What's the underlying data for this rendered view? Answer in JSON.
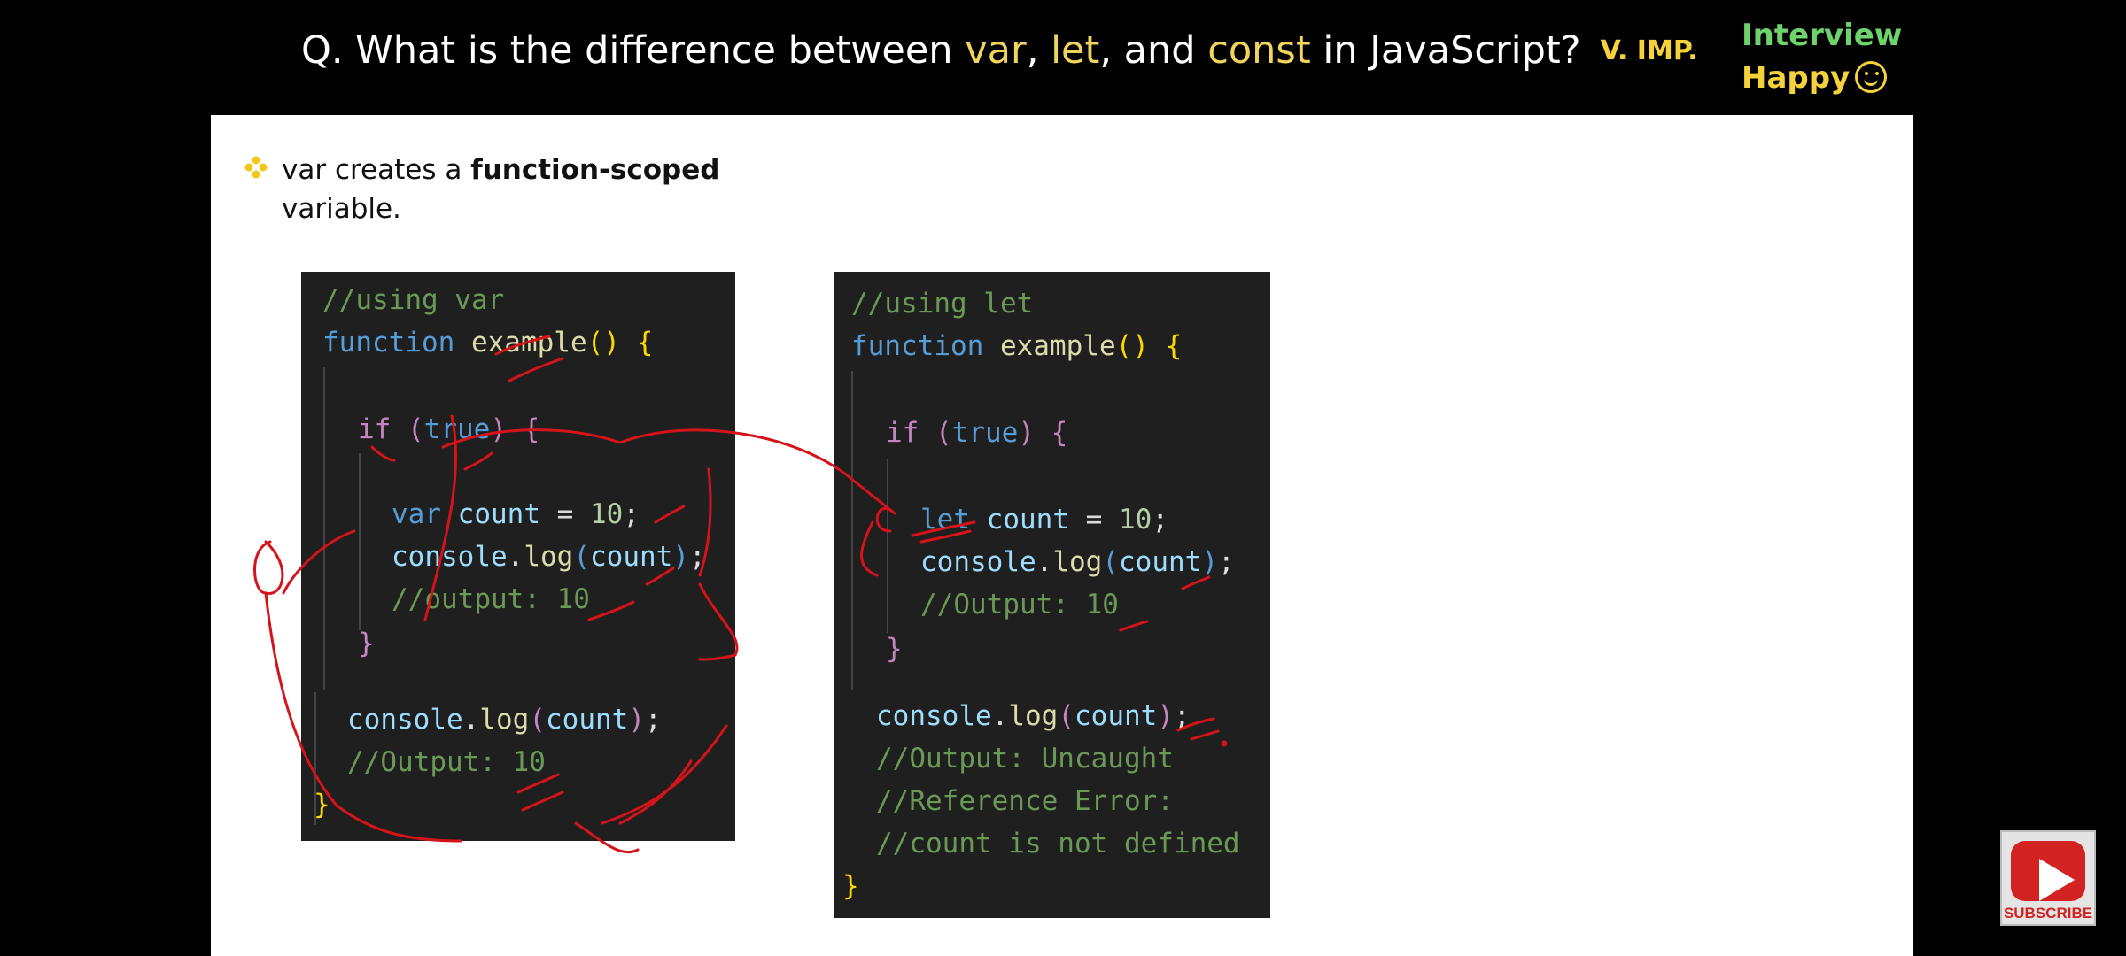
{
  "header": {
    "question_prefix": "Q. What is the difference between ",
    "kw_var": "var",
    "sep1": ", ",
    "kw_let": "let",
    "sep2": ", and ",
    "kw_const": "const",
    "question_suffix": " in JavaScript?",
    "importance": "V. IMP.",
    "brand_line1": "Interview",
    "brand_line2": "Happy"
  },
  "bullet": {
    "text_before": "var creates a ",
    "text_bold": "function-scoped",
    "text_after": "variable."
  },
  "code_var": {
    "comment": "//using var",
    "kw_function": "function",
    "fn_name": "example",
    "parens": "()",
    "brace_open": " {",
    "if_kw": "if",
    "if_open": " (",
    "if_true": "true",
    "if_close": ")",
    "if_brace": " {",
    "var_kw": "var",
    "decl_name": " count",
    "decl_eq": " = ",
    "decl_val": "10",
    "decl_end": ";",
    "log_obj": "console",
    "log_dot": ".",
    "log_fn": "log",
    "log_p1": "(",
    "log_arg": "count",
    "log_p2": ")",
    "log_end": ";",
    "inner_output": "//output: 10",
    "if_brace_close": "}",
    "outer_log_obj": "console",
    "outer_log_dot": ".",
    "outer_log_fn": "log",
    "outer_log_p1": "(",
    "outer_log_arg": "count",
    "outer_log_p2": ")",
    "outer_log_end": ";",
    "outer_output": "//Output: 10",
    "brace_close": "}"
  },
  "code_let": {
    "comment": "//using let",
    "kw_function": "function",
    "fn_name": "example",
    "parens": "()",
    "brace_open": " {",
    "if_kw": "if",
    "if_open": " (",
    "if_true": "true",
    "if_close": ")",
    "if_brace": " {",
    "let_kw": "let",
    "decl_name": " count",
    "decl_eq": " = ",
    "decl_val": "10",
    "decl_end": ";",
    "log_obj": "console",
    "log_dot": ".",
    "log_fn": "log",
    "log_p1": "(",
    "log_arg": "count",
    "log_p2": ")",
    "log_end": ";",
    "inner_output": "//Output: 10",
    "if_brace_close": "}",
    "outer_log_obj": "console",
    "outer_log_dot": ".",
    "outer_log_fn": "log",
    "outer_log_p1": "(",
    "outer_log_arg": "count",
    "outer_log_p2": ")",
    "outer_log_end": ";",
    "err1": "//Output: Uncaught",
    "err2": "//Reference Error:",
    "err3": "//count is not defined",
    "brace_close": "}"
  },
  "youtube": {
    "label": "SUBSCRIBE",
    "icon": "youtube-play-icon"
  },
  "colors": {
    "keyword_highlight": "#f1d45c",
    "importance": "#f5d23b",
    "brand_green": "#6fd36b",
    "annotation_red": "#d4141a",
    "code_bg": "#1f1f1f"
  }
}
